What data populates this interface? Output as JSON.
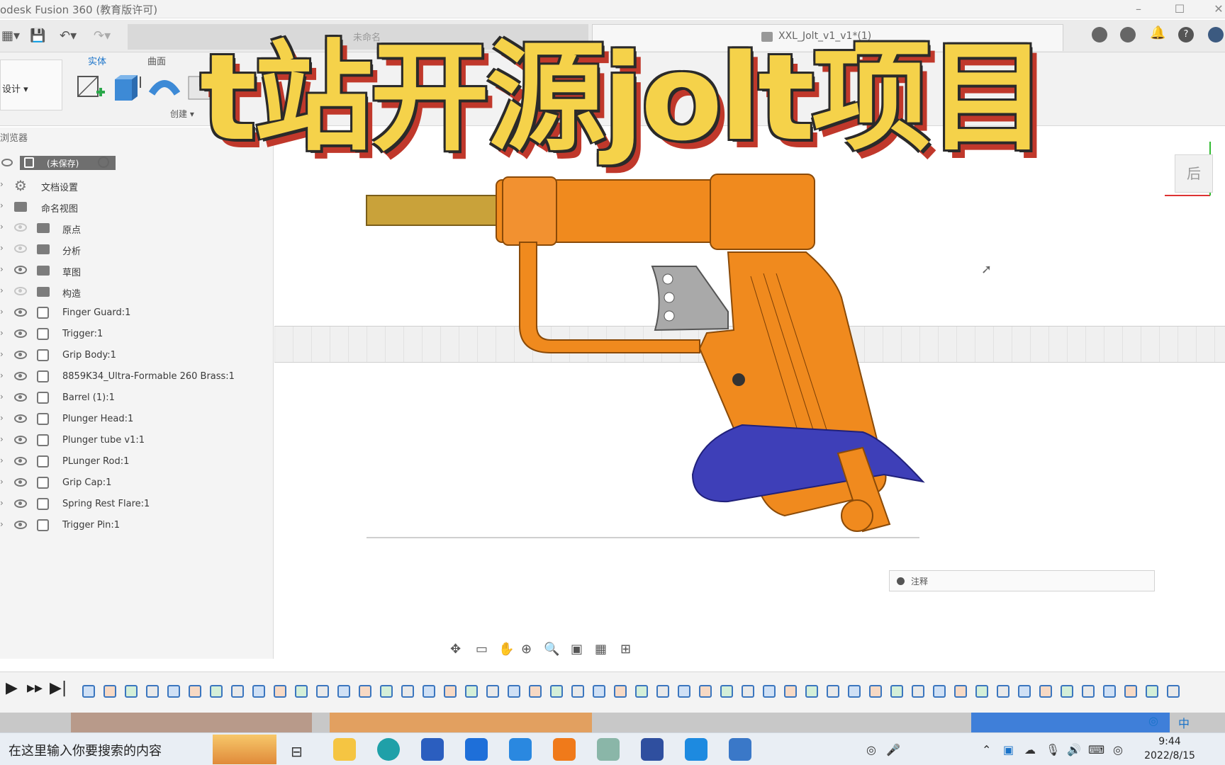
{
  "window": {
    "title": "odesk Fusion 360 (教育版许可)"
  },
  "document_tab": {
    "label": "XXL_Jolt_v1_v1*(1)",
    "ghost_label": "未命名"
  },
  "ribbon": {
    "tabs": [
      {
        "label": "实体",
        "active": true
      },
      {
        "label": "曲面",
        "active": false
      }
    ],
    "workspace_label": "设计 ▾",
    "create_label": "创建 ▾"
  },
  "browser": {
    "header": "浏览器",
    "root_label": "(未保存)",
    "items": [
      {
        "label": "文档设置",
        "kind": "gear",
        "visible": true
      },
      {
        "label": "命名视图",
        "kind": "folder",
        "visible": true
      },
      {
        "label": "原点",
        "kind": "folder",
        "visible": false
      },
      {
        "label": "分析",
        "kind": "folder",
        "visible": false
      },
      {
        "label": "草图",
        "kind": "folder",
        "visible": true
      },
      {
        "label": "构造",
        "kind": "folder",
        "visible": false
      },
      {
        "label": "Finger Guard:1",
        "kind": "component",
        "visible": true
      },
      {
        "label": "Trigger:1",
        "kind": "component",
        "visible": true
      },
      {
        "label": "Grip Body:1",
        "kind": "component",
        "visible": true
      },
      {
        "label": "8859K34_Ultra-Formable 260 Brass:1",
        "kind": "component",
        "visible": true
      },
      {
        "label": "Barrel (1):1",
        "kind": "component",
        "visible": true
      },
      {
        "label": "Plunger Head:1",
        "kind": "component",
        "visible": true
      },
      {
        "label": "Plunger tube v1:1",
        "kind": "component",
        "visible": true
      },
      {
        "label": "PLunger Rod:1",
        "kind": "component",
        "visible": true
      },
      {
        "label": "Grip Cap:1",
        "kind": "component",
        "visible": true
      },
      {
        "label": "Spring Rest Flare:1",
        "kind": "component",
        "visible": true
      },
      {
        "label": "Trigger Pin:1",
        "kind": "component",
        "visible": true
      }
    ]
  },
  "viewport": {
    "viewcube_label": "后",
    "comment_placeholder": "注释"
  },
  "overlay_title": "t站开源jolt项目",
  "taskbar": {
    "search_placeholder": "在这里输入你要搜索的内容",
    "clock_time": "9:44",
    "clock_date": "2022/8/15",
    "ime": "中"
  },
  "colors": {
    "model_orange": "#f08a1e",
    "model_blue": "#3e3fb8",
    "brass": "#c9a23a",
    "title_yellow": "#f5d24a",
    "title_red": "#c0382b",
    "accent_blue": "#1a73c9"
  }
}
